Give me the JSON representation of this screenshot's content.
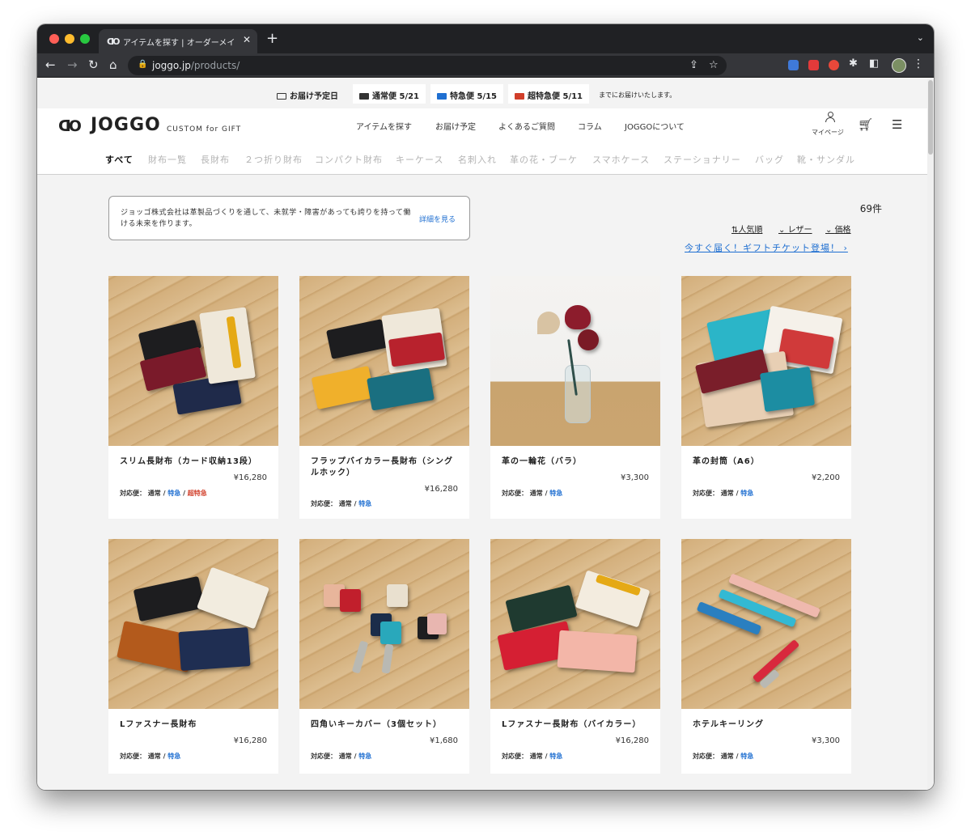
{
  "browser": {
    "tab_title": "アイテムを探す | オーダーメイド革",
    "tab_favicon": "ꓷO",
    "url_host": "joggo.jp",
    "url_path": "/products/"
  },
  "delivery_bar": {
    "label": "お届け予定日",
    "normal": "通常便 5/21",
    "express": "特急便 5/15",
    "super_express": "超特急便 5/11",
    "suffix": "までにお届けいたします。",
    "colors": {
      "normal": "#333333",
      "express": "#1f6fd1",
      "super_express": "#d13f2a"
    }
  },
  "header": {
    "logo_mark": "ꓷO",
    "logo": "JOGGO",
    "logo_sub": "CUSTOM for GIFT",
    "nav": [
      "アイテムを探す",
      "お届け予定",
      "よくあるご質問",
      "コラム",
      "JOGGOについて"
    ],
    "mypage": "マイページ"
  },
  "categories": [
    "すべて",
    "財布一覧",
    "長財布",
    "２つ折り財布",
    "コンパクト財布",
    "キーケース",
    "名刺入れ",
    "革の花・ブーケ",
    "スマホケース",
    "ステーショナリー",
    "バッグ",
    "靴・サンダル"
  ],
  "notice": {
    "text": "ジョッゴ株式会社は革製品づくりを通して、未就学・障害があっても誇りを持って働ける未来を作ります。",
    "link": "詳細を見る"
  },
  "results": {
    "count": "69件",
    "sort": [
      "人気順",
      "レザー",
      "価格"
    ],
    "gift_link": "今すぐ届く！ギフトチケット登場！ ›"
  },
  "ship_label": "対応便：",
  "ship_normal": "通常",
  "ship_express": "特急",
  "ship_super": "超特急",
  "products": [
    {
      "name": "スリム長財布（カード収納13段）",
      "price": "¥16,280"
    },
    {
      "name": "フラップバイカラー長財布（シングルホック）",
      "price": "¥16,280"
    },
    {
      "name": "革の一輪花（バラ）",
      "price": "¥3,300"
    },
    {
      "name": "革の封筒（A6）",
      "price": "¥2,200"
    },
    {
      "name": "Lファスナー長財布",
      "price": "¥16,280"
    },
    {
      "name": "四角いキーカバー（3個セット）",
      "price": "¥1,680"
    },
    {
      "name": "Lファスナー長財布（バイカラー）",
      "price": "¥16,280"
    },
    {
      "name": "ホテルキーリング",
      "price": "¥3,300"
    }
  ]
}
